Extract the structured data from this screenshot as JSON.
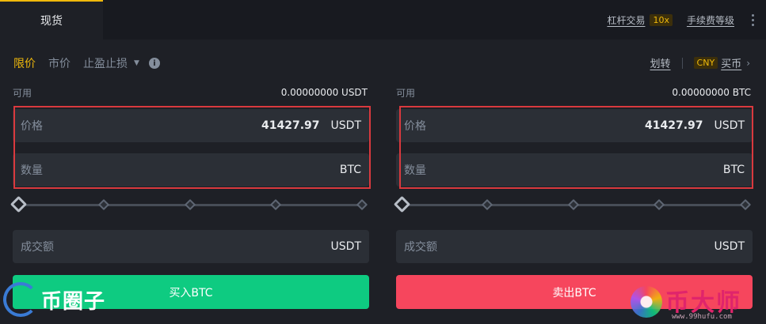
{
  "top": {
    "tab_label": "现货",
    "margin_link": "杠杆交易",
    "leverage_badge": "10x",
    "fee_link": "手续费等级"
  },
  "order_types": {
    "limit": "限价",
    "market": "市价",
    "stop": "止盈止损"
  },
  "tools": {
    "transfer": "划转",
    "currency": "CNY",
    "buy_coin": "买币"
  },
  "buy_panel": {
    "available_label": "可用",
    "available_value": "0.00000000 USDT",
    "price_label": "价格",
    "price_value": "41427.97",
    "price_unit": "USDT",
    "amount_label": "数量",
    "amount_unit": "BTC",
    "slider_percent": 0,
    "total_label": "成交额",
    "total_unit": "USDT",
    "button_label": "买入BTC"
  },
  "sell_panel": {
    "available_label": "可用",
    "available_value": "0.00000000 BTC",
    "price_label": "价格",
    "price_value": "41427.97",
    "price_unit": "USDT",
    "amount_label": "数量",
    "amount_unit": "BTC",
    "slider_percent": 0,
    "total_label": "成交额",
    "total_unit": "USDT",
    "button_label": "卖出BTC"
  },
  "watermarks": {
    "left_text": "币圈子",
    "right_text": "币大师",
    "right_url": "www.99hufu.com"
  },
  "colors": {
    "accent": "#f0b90b",
    "buy": "#0ecb81",
    "sell": "#f6465d",
    "highlight": "#d9393e"
  }
}
